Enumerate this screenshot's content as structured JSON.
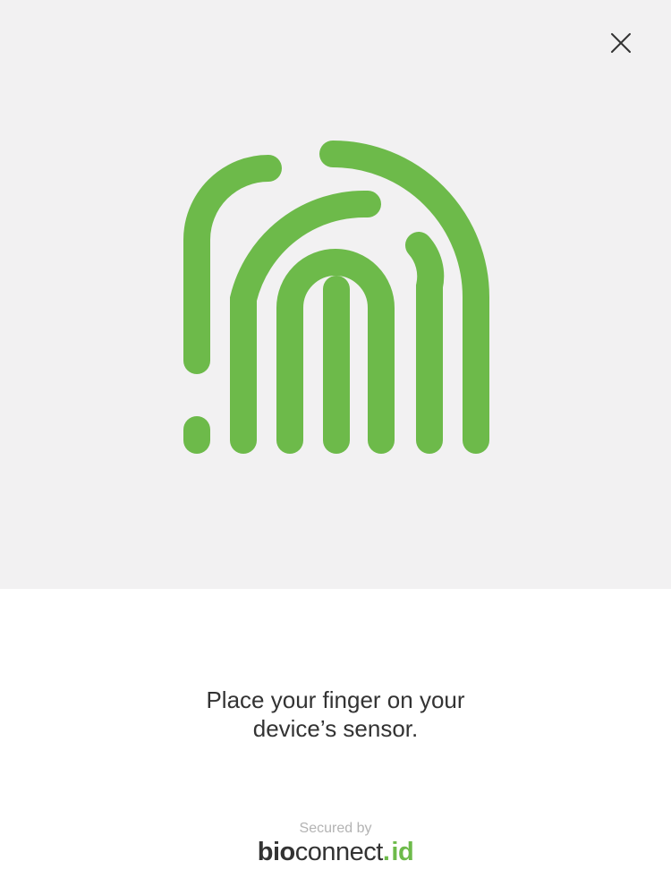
{
  "header": {
    "close_icon": "close-icon"
  },
  "fingerprint": {
    "icon": "fingerprint-icon",
    "color": "#6dba4a",
    "background": "#f2f1f2"
  },
  "instruction": {
    "line1": "Place your finger on your",
    "line2": "device’s sensor."
  },
  "footer": {
    "secured_by": "Secured by",
    "brand_bold": "bio",
    "brand_light": "connect",
    "brand_dot": ".",
    "brand_tld": "id",
    "brand_accent_color": "#6dba4a"
  }
}
